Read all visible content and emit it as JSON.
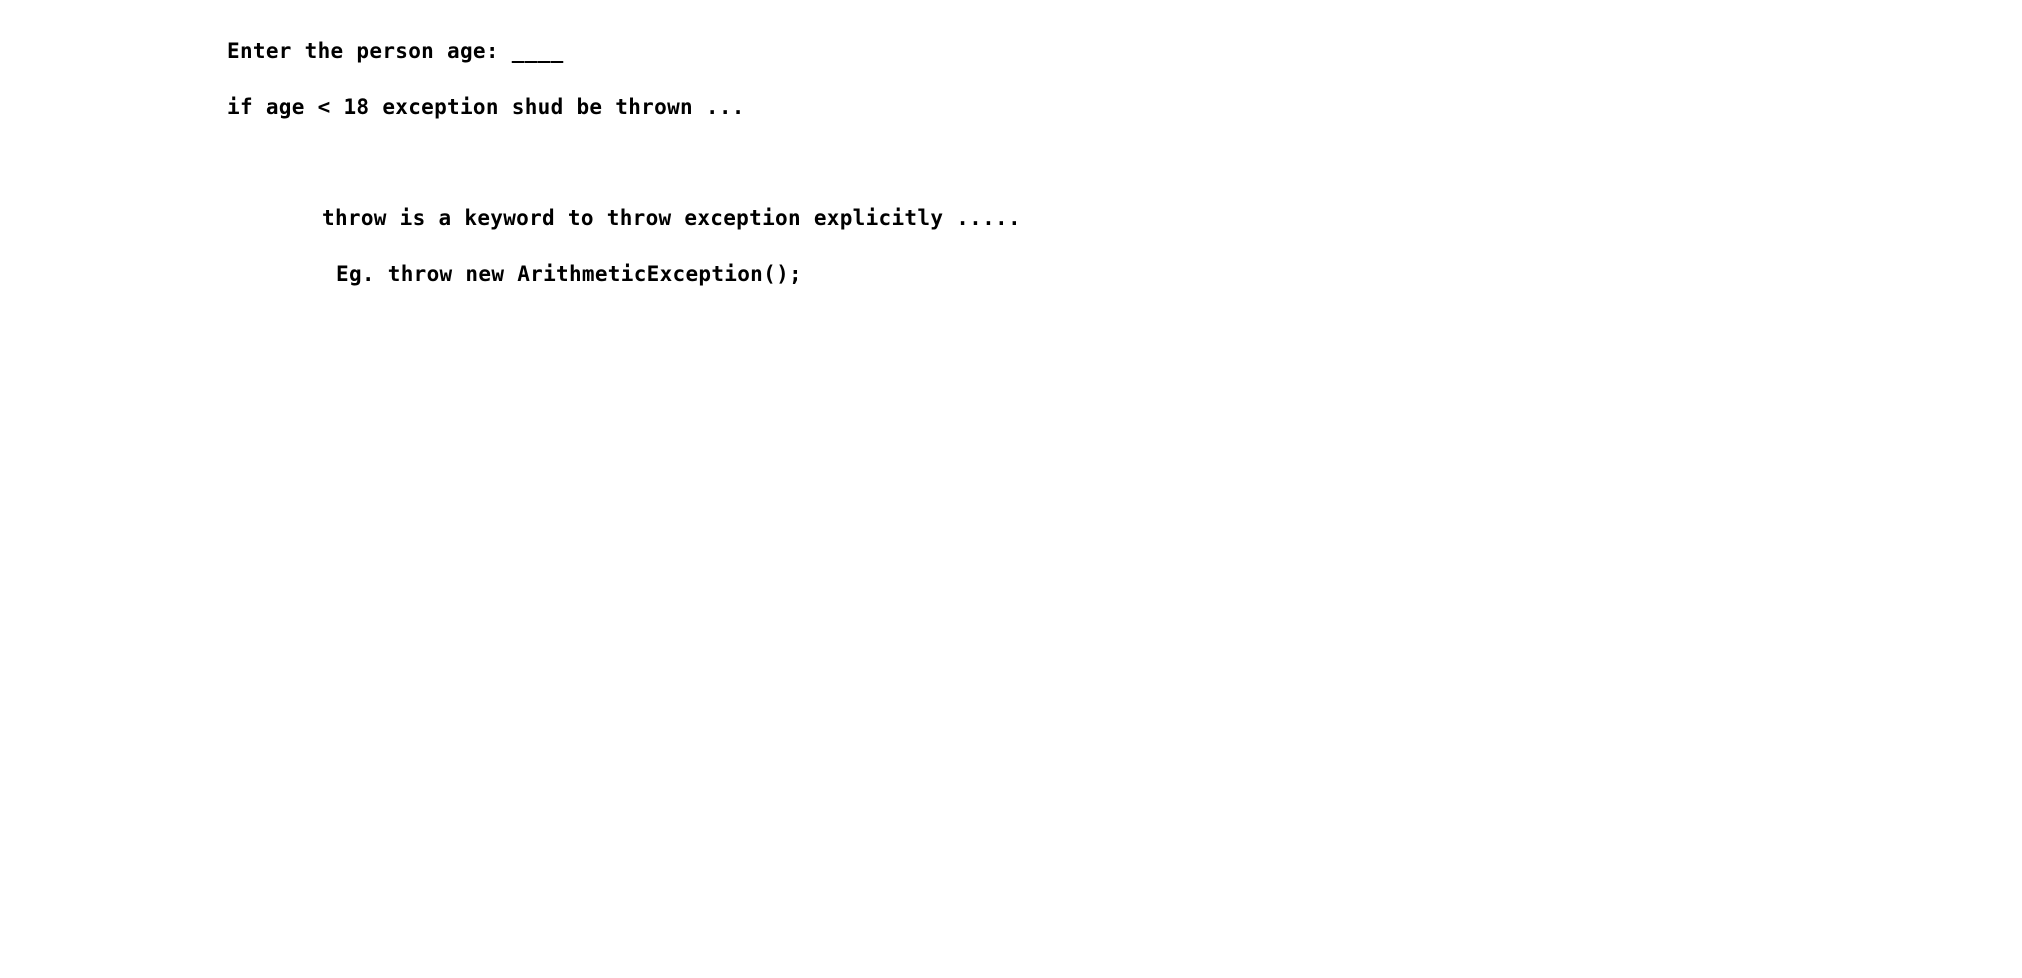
{
  "note": {
    "line1": "Enter the person age: ____",
    "line2": "if age < 18 exception shud be thrown ...",
    "line3": "throw is a keyword to throw exception explicitly .....",
    "line4": "Eg. throw new ArithmeticException();"
  },
  "colors": {
    "background": "#ffffff",
    "text": "#000000"
  }
}
